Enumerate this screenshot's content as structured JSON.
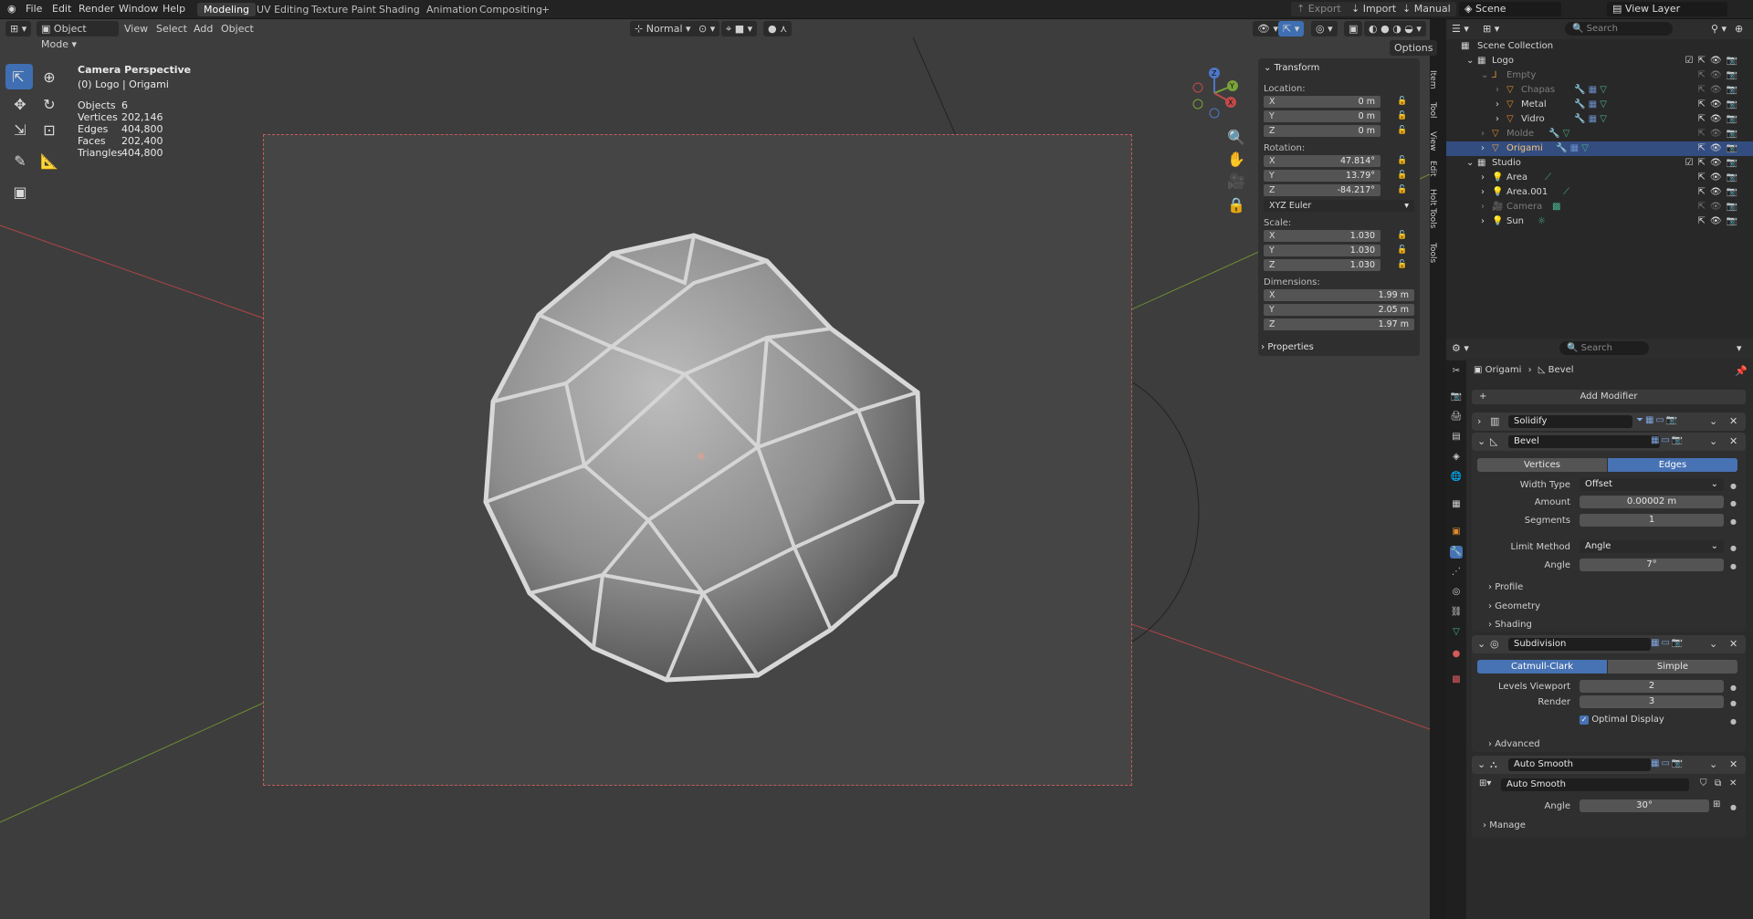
{
  "topbar": {
    "menus": [
      "File",
      "Edit",
      "Render",
      "Window",
      "Help"
    ],
    "workspaces": [
      "Modeling",
      "UV Editing",
      "Texture Paint",
      "Shading",
      "Animation",
      "Compositing"
    ],
    "active_workspace": "Modeling",
    "add_tab": "+",
    "export_label": "Export",
    "import_label": "Import",
    "manual_label": "Manual",
    "scene_label": "Scene",
    "view_layer_label": "View Layer"
  },
  "viewport_header": {
    "mode": "Object Mode",
    "menus": [
      "View",
      "Select",
      "Add",
      "Object"
    ],
    "orientation": "Normal",
    "options_label": "Options"
  },
  "overlay": {
    "camera_title": "Camera Perspective",
    "context": "(0) Logo | Origami",
    "stats": [
      {
        "label": "Objects",
        "value": "6"
      },
      {
        "label": "Vertices",
        "value": "202,146"
      },
      {
        "label": "Edges",
        "value": "404,800"
      },
      {
        "label": "Faces",
        "value": "202,400"
      },
      {
        "label": "Triangles",
        "value": "404,800"
      }
    ]
  },
  "npanel": {
    "transform_title": "Transform",
    "location_label": "Location:",
    "location": [
      {
        "axis": "X",
        "value": "0 m"
      },
      {
        "axis": "Y",
        "value": "0 m"
      },
      {
        "axis": "Z",
        "value": "0 m"
      }
    ],
    "rotation_label": "Rotation:",
    "rotation": [
      {
        "axis": "X",
        "value": "47.814°"
      },
      {
        "axis": "Y",
        "value": "13.79°"
      },
      {
        "axis": "Z",
        "value": "-84.217°"
      }
    ],
    "rotation_mode": "XYZ Euler",
    "scale_label": "Scale:",
    "scale": [
      {
        "axis": "X",
        "value": "1.030"
      },
      {
        "axis": "Y",
        "value": "1.030"
      },
      {
        "axis": "Z",
        "value": "1.030"
      }
    ],
    "dimensions_label": "Dimensions:",
    "dimensions": [
      {
        "axis": "X",
        "value": "1.99 m"
      },
      {
        "axis": "Y",
        "value": "2.05 m"
      },
      {
        "axis": "Z",
        "value": "1.97 m"
      }
    ],
    "properties_label": "Properties",
    "side_tabs": [
      "Item",
      "Tool",
      "View",
      "Edit",
      "Holt Tools",
      "Tools"
    ]
  },
  "outliner": {
    "search_placeholder": "Search",
    "rows": [
      {
        "name": "Scene Collection",
        "depth": 0,
        "type": "collection"
      },
      {
        "name": "Logo",
        "depth": 1,
        "type": "collection"
      },
      {
        "name": "Empty",
        "depth": 2,
        "type": "empty",
        "dim": true
      },
      {
        "name": "Chapas",
        "depth": 3,
        "type": "mesh",
        "dim": true
      },
      {
        "name": "Metal",
        "depth": 3,
        "type": "mesh"
      },
      {
        "name": "Vidro",
        "depth": 3,
        "type": "mesh"
      },
      {
        "name": "Molde",
        "depth": 2,
        "type": "mesh",
        "dim": true
      },
      {
        "name": "Origami",
        "depth": 2,
        "type": "mesh",
        "selected": true
      },
      {
        "name": "Studio",
        "depth": 1,
        "type": "collection"
      },
      {
        "name": "Area",
        "depth": 2,
        "type": "light"
      },
      {
        "name": "Area.001",
        "depth": 2,
        "type": "light"
      },
      {
        "name": "Camera",
        "depth": 2,
        "type": "camera",
        "dim": true
      },
      {
        "name": "Sun",
        "depth": 2,
        "type": "light"
      }
    ]
  },
  "properties": {
    "search_placeholder": "Search",
    "breadcrumb_object": "Origami",
    "breadcrumb_modifier": "Bevel",
    "add_modifier": "Add Modifier",
    "solidify": {
      "name": "Solidify"
    },
    "bevel": {
      "name": "Bevel",
      "affect_options": [
        "Vertices",
        "Edges"
      ],
      "affect_active": "Edges",
      "width_type_label": "Width Type",
      "width_type": "Offset",
      "amount_label": "Amount",
      "amount": "0.00002 m",
      "segments_label": "Segments",
      "segments": "1",
      "limit_method_label": "Limit Method",
      "limit_method": "Angle",
      "angle_label": "Angle",
      "angle": "7°",
      "subsections": [
        "Profile",
        "Geometry",
        "Shading"
      ]
    },
    "subdivision": {
      "name": "Subdivision",
      "types": [
        "Catmull-Clark",
        "Simple"
      ],
      "type_active": "Catmull-Clark",
      "levels_viewport_label": "Levels Viewport",
      "levels_viewport": "2",
      "render_label": "Render",
      "render": "3",
      "optimal_display_label": "Optimal Display",
      "advanced_label": "Advanced"
    },
    "auto_smooth": {
      "name": "Auto Smooth",
      "node_group": "Auto Smooth",
      "angle_label": "Angle",
      "angle": "30°",
      "manage_label": "Manage"
    }
  },
  "colors": {
    "accent": "#4772b3",
    "viewport_bg": "#3d3d3d",
    "axis_x": "#c24a4a",
    "axis_y": "#7a9a3c"
  }
}
